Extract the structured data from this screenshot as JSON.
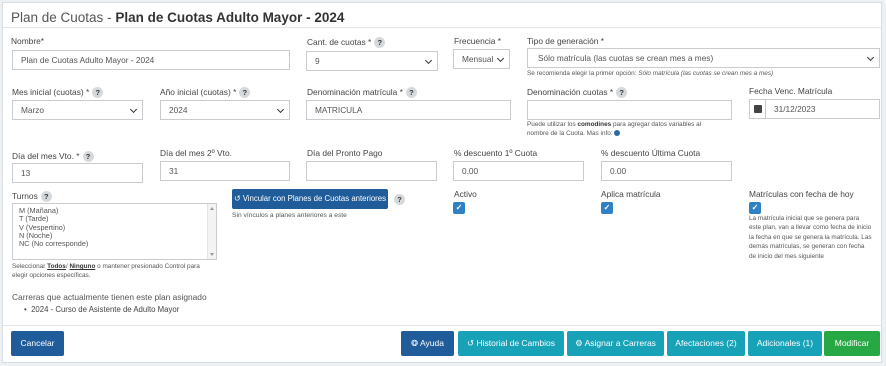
{
  "header": {
    "prefix": "Plan de Cuotas - ",
    "plan_name": "Plan de Cuotas Adulto Mayor - 2024"
  },
  "form": {
    "nombre": {
      "label": "Nombre*",
      "value": "Plan de Cuotas Adulto Mayor - 2024"
    },
    "cant_cuotas": {
      "label": "Cant. de cuotas *",
      "value": "9"
    },
    "frecuencia": {
      "label": "Frecuencia *",
      "value": "Mensual"
    },
    "tipo_generacion": {
      "label": "Tipo de generación *",
      "value": "Sólo matrícula (las cuotas se crean mes a mes)",
      "help_prefix": "Se recomienda elegir la primer opción: ",
      "help_italic": "Sólo matrícula (las cuotas se crean mes a mes)"
    },
    "mes_inicial": {
      "label": "Mes inicial (cuotas) *",
      "value": "Marzo"
    },
    "anio_inicial": {
      "label": "Año inicial (cuotas) *",
      "value": "2024"
    },
    "denom_matricula": {
      "label": "Denominación matrícula *",
      "value": "MATRICULA"
    },
    "denom_cuotas": {
      "label": "Denominación cuotas *",
      "value": "",
      "help_1": "Puede utilizar los ",
      "help_bold": "comodines",
      "help_2": " para agregar datos variables al",
      "help_3": "nombre de la Cuota. Mas info: "
    },
    "fecha_venc": {
      "label": "Fecha Venc. Matrícula",
      "value": "31/12/2023"
    },
    "dia_vto": {
      "label": "Día del mes Vto. *",
      "value": "13"
    },
    "dia_2vto": {
      "label": "Día del mes 2º Vto.",
      "value": "31"
    },
    "dia_pronto_pago": {
      "label": "Día del Pronto Pago",
      "value": ""
    },
    "desc_1ra": {
      "label": "% descuento 1º Cuota",
      "value": "0.00"
    },
    "desc_ultima": {
      "label": "% descuento Última Cuota",
      "value": "0.00"
    },
    "turnos": {
      "label": "Turnos",
      "options": [
        "M (Mañana)",
        "T (Tarde)",
        "V (Vespertino)",
        "N (Noche)",
        "NC (No corresponde)"
      ],
      "help_1": "Seleccionar ",
      "todos": "Todos",
      "slash": "/ ",
      "ninguno": "Ninguno",
      "help_2": " o mantener presionado Control para",
      "help_3": "elegir opciones específicas."
    },
    "vincular": {
      "label": "Vincular con Planes de Cuotas anteriores",
      "note": "Sin vínculos a planes anteriores a este"
    },
    "activo": {
      "label": "Activo",
      "checked": true
    },
    "aplica_matricula": {
      "label": "Aplica matrícula",
      "checked": true
    },
    "matriculas_fecha_hoy": {
      "label": "Matrículas con fecha de hoy",
      "checked": true,
      "help": [
        "La matrícula inicial que se genera para",
        "este plan, van a llevar como fecha de inicio",
        "la fecha en que se genera la matrícula. Las",
        "demás matrículas, se generan con fecha",
        "de inicio del mes siguiente"
      ]
    }
  },
  "carreras": {
    "title": "Carreras que actualmente tienen este plan asignado",
    "items": [
      "2024 - Curso de Asistente de Adulto Mayor"
    ]
  },
  "footer": {
    "cancelar": "Cancelar",
    "ayuda": "Ayuda",
    "historial": "Historial de Cambios",
    "asignar": "Asignar a Carreras",
    "afectaciones": "Afectaciones (2)",
    "adicionales": "Adicionales (1)",
    "modificar": "Modificar"
  },
  "icons": {
    "help": "question-circle-icon",
    "calendar": "calendar-icon",
    "link": "undo-link-icon",
    "ayuda": "life-ring-icon",
    "historial": "history-icon",
    "asignar": "gear-icon",
    "info": "info-icon"
  },
  "colors": {
    "primary": "#1f5c99",
    "teal": "#17a2b8",
    "green": "#28a745",
    "check": "#2f80c5"
  }
}
